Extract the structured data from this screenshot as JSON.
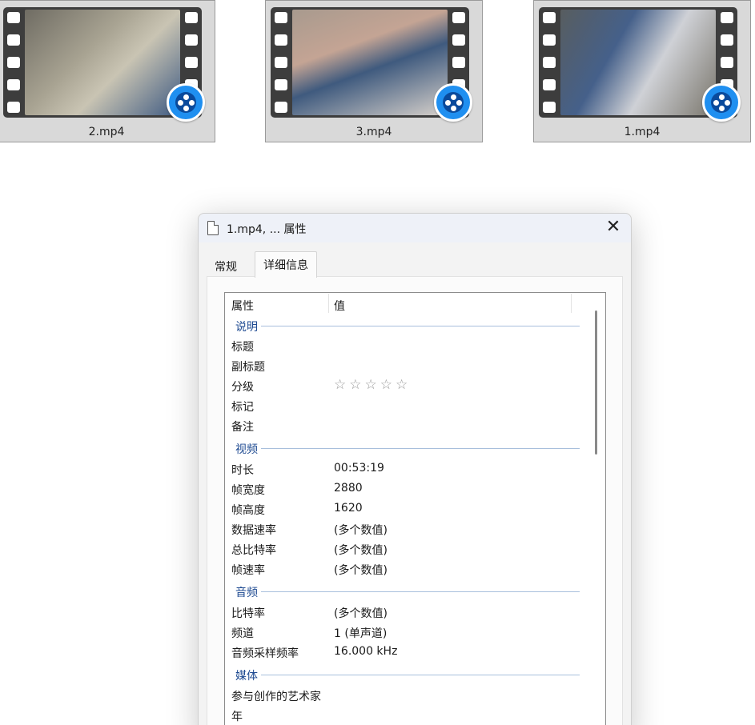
{
  "thumbnails": [
    {
      "filename": "2.mp4",
      "frame_colors": [
        "#7d7a70",
        "#b9b4a3",
        "#3e5a82"
      ]
    },
    {
      "filename": "3.mp4",
      "frame_colors": [
        "#9c8f86",
        "#3f5a7e",
        "#d7d1cb"
      ]
    },
    {
      "filename": "1.mp4",
      "frame_colors": [
        "#585d5f",
        "#cfd1d6",
        "#45608a"
      ]
    }
  ],
  "dialog": {
    "title": "1.mp4, ... 属性",
    "tabs": [
      "常规",
      "详细信息"
    ],
    "active_tab": "详细信息",
    "columns": {
      "property": "属性",
      "value": "值"
    },
    "sections": [
      {
        "name": "说明",
        "rows": [
          {
            "k": "标题",
            "v": ""
          },
          {
            "k": "副标题",
            "v": ""
          },
          {
            "k": "分级",
            "v": "☆☆☆☆☆"
          },
          {
            "k": "标记",
            "v": ""
          },
          {
            "k": "备注",
            "v": ""
          }
        ]
      },
      {
        "name": "视频",
        "rows": [
          {
            "k": "时长",
            "v": "00:53:19"
          },
          {
            "k": "帧宽度",
            "v": "2880"
          },
          {
            "k": "帧高度",
            "v": "1620"
          },
          {
            "k": "数据速率",
            "v": "(多个数值)"
          },
          {
            "k": "总比特率",
            "v": "(多个数值)"
          },
          {
            "k": "帧速率",
            "v": "(多个数值)"
          }
        ]
      },
      {
        "name": "音频",
        "rows": [
          {
            "k": "比特率",
            "v": "(多个数值)"
          },
          {
            "k": "频道",
            "v": "1 (单声道)"
          },
          {
            "k": "音频采样频率",
            "v": "16.000 kHz"
          }
        ]
      },
      {
        "name": "媒体",
        "rows": [
          {
            "k": "参与创作的艺术家",
            "v": ""
          },
          {
            "k": "年",
            "v": ""
          }
        ]
      }
    ],
    "rating_stars": 0
  },
  "colors": {
    "accent_blue": "#1f8ff0",
    "section_header": "#1e4a91"
  }
}
